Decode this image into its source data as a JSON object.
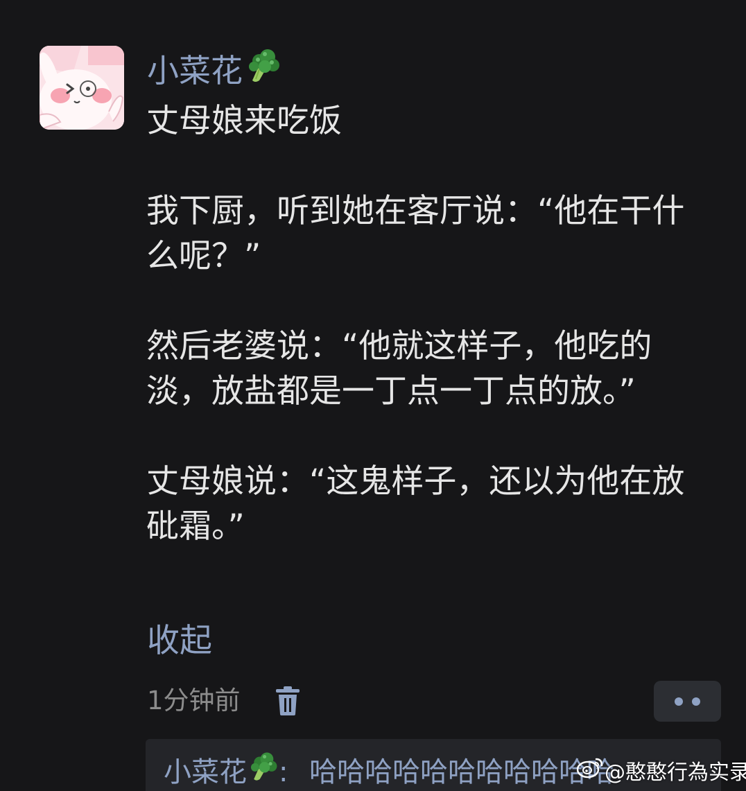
{
  "comment": {
    "username": "小菜花",
    "username_emoji": "broccoli-icon",
    "paragraphs": [
      "丈母娘来吃饭",
      "我下厨，听到她在客厅说：“他在干什么呢？”",
      "然后老婆说：“他就这样子，他吃的淡，放盐都是一丁点一丁点的放。”",
      "丈母娘说：“这鬼样子，还以为他在放砒霜。”"
    ],
    "collapse_label": "收起",
    "timestamp": "1分钟前",
    "delete_icon": "trash-icon",
    "more_icon": "more-dots-icon"
  },
  "reply": {
    "username": "小菜花",
    "separator": ":",
    "text": "哈哈哈哈哈哈哈哈哈哈哈"
  },
  "watermark": {
    "text": "@憨憨行為实录",
    "icon": "weibo-icon"
  },
  "colors": {
    "background": "#161618",
    "username": "#8fa2c4",
    "text": "#e6e6e6",
    "meta": "#8c8c8c",
    "reply_bg": "#242529",
    "button_bg": "#2c2e33"
  }
}
